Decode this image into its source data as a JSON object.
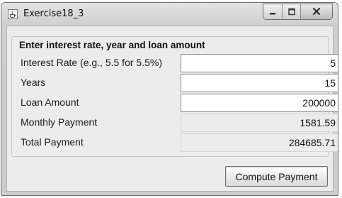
{
  "window": {
    "title": "Exercise18_3"
  },
  "icons": {
    "app": "java-app-icon",
    "minimize": "minimize-icon",
    "maximize": "maximize-icon",
    "close": "close-icon"
  },
  "panel": {
    "title": "Enter interest rate, year and loan amount",
    "rows": [
      {
        "label": "Interest Rate (e.g., 5.5 for 5.5%)",
        "value": "5",
        "editable": true
      },
      {
        "label": "Years",
        "value": "15",
        "editable": true
      },
      {
        "label": "Loan Amount",
        "value": "200000",
        "editable": true
      },
      {
        "label": "Monthly Payment",
        "value": "1581.59",
        "editable": false
      },
      {
        "label": "Total Payment",
        "value": "284685.71",
        "editable": false
      }
    ]
  },
  "actions": {
    "compute_label": "Compute Payment"
  }
}
